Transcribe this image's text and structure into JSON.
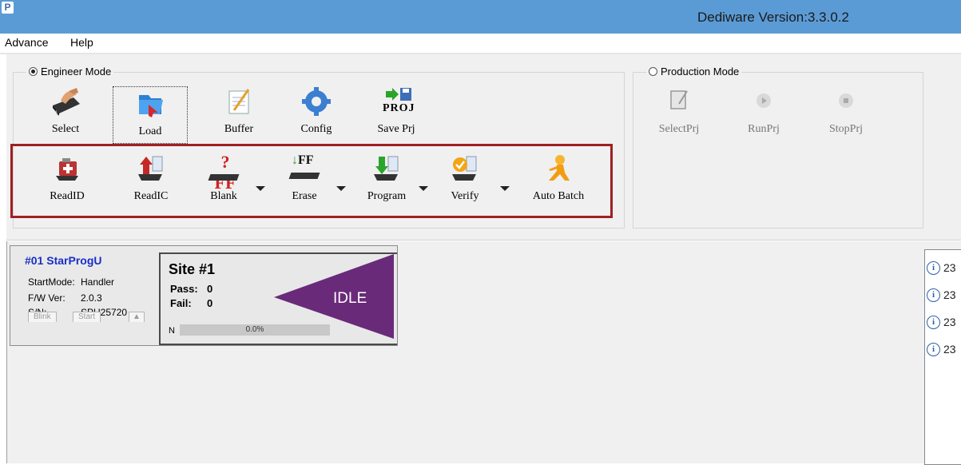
{
  "window": {
    "app_icon": "dediware-icon",
    "title": "Dediware Version:3.3.0.2"
  },
  "menu": {
    "items": [
      "Advance",
      "Help"
    ]
  },
  "engineer_mode": {
    "label": "Engineer Mode",
    "selected": true,
    "top_buttons": [
      {
        "label": "Select",
        "icon": "chip-select-icon"
      },
      {
        "label": "Load",
        "icon": "folder-load-icon"
      },
      {
        "label": "Buffer",
        "icon": "notepad-buffer-icon"
      },
      {
        "label": "Config",
        "icon": "gear-config-icon"
      },
      {
        "label": "Save Prj",
        "icon": "save-project-icon",
        "icon_text": "PROJ"
      }
    ],
    "op_buttons": [
      {
        "label": "ReadID",
        "icon": "readid-icon"
      },
      {
        "label": "ReadIC",
        "icon": "readic-icon"
      },
      {
        "label": "Blank",
        "icon": "blank-icon",
        "icon_text": "?FF"
      },
      {
        "label": "Erase",
        "icon": "erase-icon",
        "icon_text": "FF"
      },
      {
        "label": "Program",
        "icon": "program-icon"
      },
      {
        "label": "Verify",
        "icon": "verify-icon"
      },
      {
        "label": "Auto Batch",
        "icon": "auto-batch-icon"
      }
    ]
  },
  "production_mode": {
    "label": "Production Mode",
    "selected": false,
    "buttons": [
      {
        "label": "SelectPrj",
        "icon": "select-project-icon"
      },
      {
        "label": "RunPrj",
        "icon": "run-project-icon"
      },
      {
        "label": "StopPrj",
        "icon": "stop-project-icon"
      }
    ]
  },
  "device": {
    "name": "#01 StarProgU",
    "rows": [
      {
        "label": "StartMode:",
        "value": "Handler"
      },
      {
        "label": "F/W Ver:",
        "value": "2.0.3"
      },
      {
        "label": "S/N:",
        "value": "SPU25720"
      }
    ],
    "buttons": [
      "Blink",
      "Start"
    ]
  },
  "site": {
    "title": "Site #1",
    "pass_label": "Pass:",
    "pass_value": "0",
    "fail_label": "Fail:",
    "fail_value": "0",
    "status": "IDLE",
    "progress_label": "N",
    "progress_text": "0.0%",
    "progress_fraction": 0.0
  },
  "log": {
    "entries": [
      "23",
      "23",
      "23",
      "23"
    ]
  },
  "colors": {
    "titlebar": "#5b9bd5",
    "highlight_box": "#a01f22",
    "idle_purple": "#6a2a7a",
    "device_name": "#1a2ec8"
  }
}
